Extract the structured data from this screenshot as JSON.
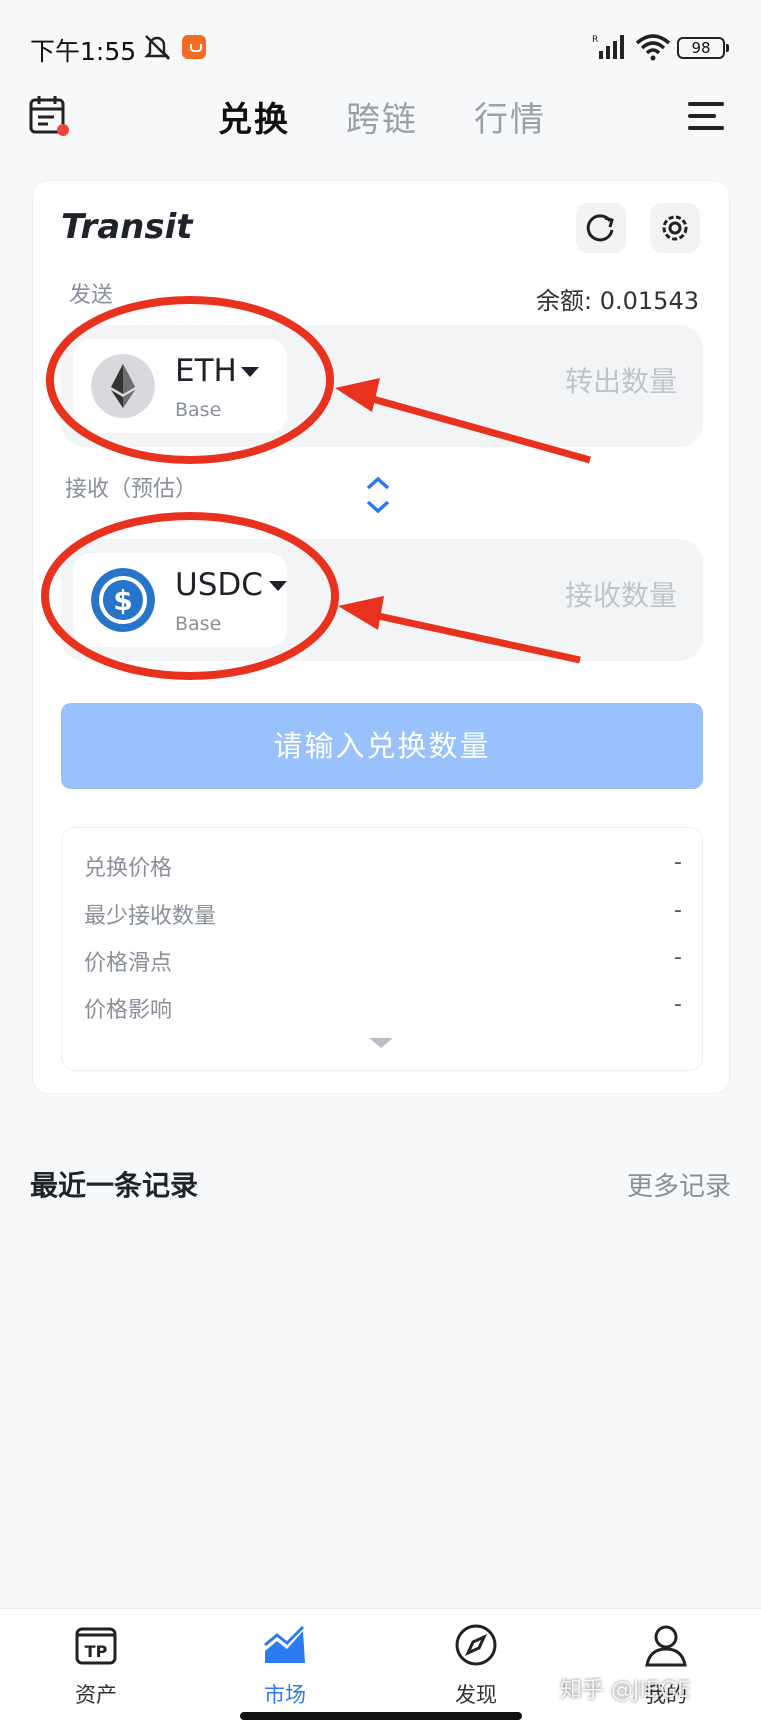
{
  "status_bar": {
    "time": "下午1:55",
    "battery": "98"
  },
  "header": {
    "tabs": [
      {
        "label": "兑换",
        "active": true
      },
      {
        "label": "跨链",
        "active": false
      },
      {
        "label": "行情",
        "active": false
      }
    ]
  },
  "swap_card": {
    "brand": "Transit",
    "send": {
      "label": "发送",
      "balance": "余额: 0.01543",
      "token_symbol": "ETH",
      "token_chain": "Base",
      "amount_placeholder": "转出数量"
    },
    "receive": {
      "label": "接收（预估）",
      "token_symbol": "USDC",
      "token_chain": "Base",
      "amount_placeholder": "接收数量"
    },
    "cta_label": "请输入兑换数量",
    "info": [
      {
        "label": "兑换价格",
        "value": "-"
      },
      {
        "label": "最少接收数量",
        "value": "-"
      },
      {
        "label": "价格滑点",
        "value": "-"
      },
      {
        "label": "价格影响",
        "value": "-"
      }
    ]
  },
  "recent": {
    "title": "最近一条记录",
    "more": "更多记录"
  },
  "bottom_nav": [
    {
      "label": "资产",
      "icon": "tp-wallet-icon",
      "active": false
    },
    {
      "label": "市场",
      "icon": "chart-icon",
      "active": true
    },
    {
      "label": "发现",
      "icon": "compass-icon",
      "active": false
    },
    {
      "label": "我的",
      "icon": "user-icon",
      "active": false
    }
  ],
  "watermark": "知乎 @JIEGE",
  "colors": {
    "accent": "#2b7bf0",
    "cta_disabled": "#99c1fb",
    "annotation": "#e8321e"
  }
}
